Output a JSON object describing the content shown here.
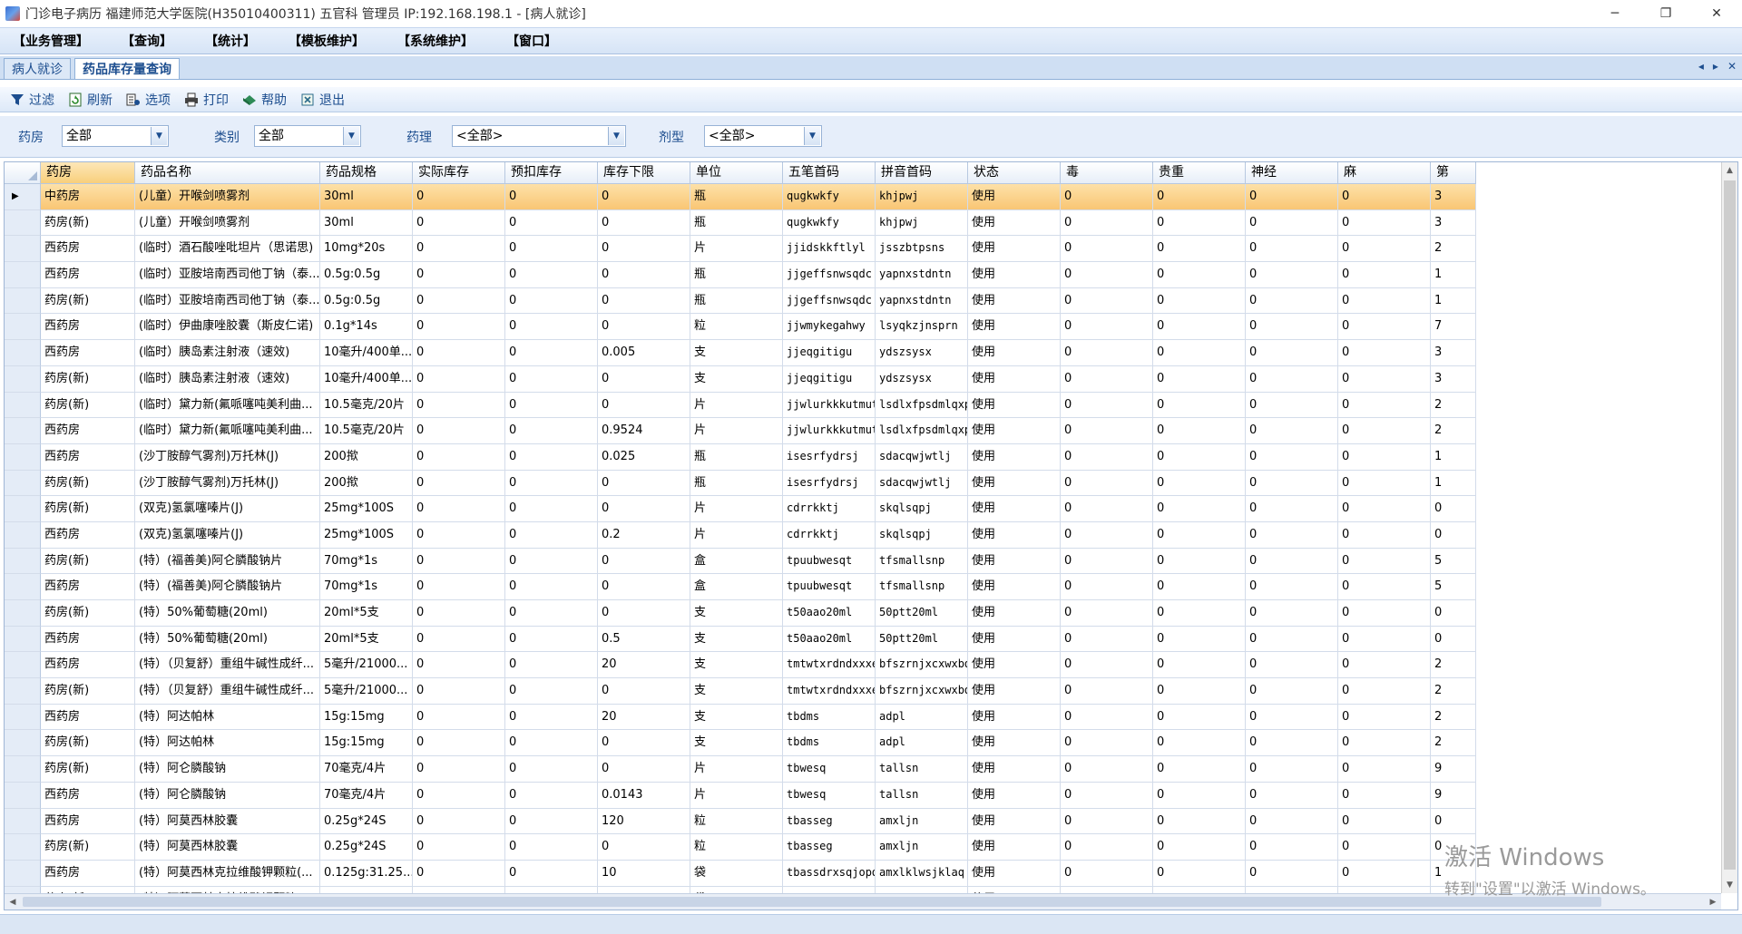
{
  "window": {
    "title": "门诊电子病历  福建师范大学医院(H35010400311)  五官科  管理员 IP:192.168.198.1 - [病人就诊]",
    "min_label": "─",
    "max_label": "❐",
    "close_label": "✕"
  },
  "menu": [
    "【业务管理】",
    "【查询】",
    "【统计】",
    "【模板维护】",
    "【系统维护】",
    "【窗口】"
  ],
  "tabs": {
    "inactive": "病人就诊",
    "active": "药品库存量查询",
    "nav_prev": "◂",
    "nav_next": "▸",
    "nav_close": "✕"
  },
  "toolbar": [
    {
      "label": "过滤",
      "icon": "filter-icon"
    },
    {
      "label": "刷新",
      "icon": "refresh-icon"
    },
    {
      "label": "选项",
      "icon": "options-icon"
    },
    {
      "label": "打印",
      "icon": "print-icon"
    },
    {
      "label": "帮助",
      "icon": "help-icon"
    },
    {
      "label": "退出",
      "icon": "exit-icon"
    }
  ],
  "filters": {
    "pharmacy": {
      "label": "药房",
      "value": "全部"
    },
    "category": {
      "label": "类别",
      "value": "全部"
    },
    "pharmacology": {
      "label": "药理",
      "value": "<全部>"
    },
    "dosage_form": {
      "label": "剂型",
      "value": "<全部>"
    }
  },
  "grid": {
    "columns": [
      "药房",
      "药品名称",
      "药品规格",
      "实际库存",
      "预扣库存",
      "库存下限",
      "单位",
      "五笔首码",
      "拼音首码",
      "状态",
      "毒",
      "贵重",
      "神经",
      "麻",
      "第"
    ],
    "current_row_marker": "▶",
    "rows": [
      [
        "中药房",
        "(儿童）开喉剑喷雾剂",
        "30ml",
        "0",
        "0",
        "0",
        "瓶",
        "qugkwkfy",
        "khjpwj",
        "使用",
        "0",
        "0",
        "0",
        "0",
        "3"
      ],
      [
        "药房(新)",
        "(儿童）开喉剑喷雾剂",
        "30ml",
        "0",
        "0",
        "0",
        "瓶",
        "qugkwkfy",
        "khjpwj",
        "使用",
        "0",
        "0",
        "0",
        "0",
        "3"
      ],
      [
        "西药房",
        "(临时）酒石酸唑吡坦片（思诺思)",
        "10mg*20s",
        "0",
        "0",
        "0",
        "片",
        "jjidskkftlyl",
        "jsszbtpsns",
        "使用",
        "0",
        "0",
        "0",
        "0",
        "2"
      ],
      [
        "西药房",
        "(临时）亚胺培南西司他丁钠（泰...",
        "0.5g:0.5g",
        "0",
        "0",
        "0",
        "瓶",
        "jjgeffsnwsqdc",
        "yapnxstdntn",
        "使用",
        "0",
        "0",
        "0",
        "0",
        "1"
      ],
      [
        "药房(新)",
        "(临时）亚胺培南西司他丁钠（泰...",
        "0.5g:0.5g",
        "0",
        "0",
        "0",
        "瓶",
        "jjgeffsnwsqdc",
        "yapnxstdntn",
        "使用",
        "0",
        "0",
        "0",
        "0",
        "1"
      ],
      [
        "西药房",
        "(临时）伊曲康唑胶囊（斯皮仁诺)",
        "0.1g*14s",
        "0",
        "0",
        "0",
        "粒",
        "jjwmykegahwy",
        "lsyqkzjnsprn",
        "使用",
        "0",
        "0",
        "0",
        "0",
        "7"
      ],
      [
        "西药房",
        "(临时）胰岛素注射液（速效)",
        "10毫升/400单...",
        "0",
        "0",
        "0.005",
        "支",
        "jjeqgitigu",
        "ydszsysx",
        "使用",
        "0",
        "0",
        "0",
        "0",
        "3"
      ],
      [
        "药房(新)",
        "(临时）胰岛素注射液（速效)",
        "10毫升/400单...",
        "0",
        "0",
        "0",
        "支",
        "jjeqgitigu",
        "ydszsysx",
        "使用",
        "0",
        "0",
        "0",
        "0",
        "3"
      ],
      [
        "药房(新)",
        "(临时）黛力新(氟哌噻吨美利曲...",
        "10.5毫克/20片",
        "0",
        "0",
        "0",
        "片",
        "jjwlurkkkutmut",
        "lsdlxfpsdmlqxp",
        "使用",
        "0",
        "0",
        "0",
        "0",
        "2"
      ],
      [
        "西药房",
        "(临时）黛力新(氟哌噻吨美利曲...",
        "10.5毫克/20片",
        "0",
        "0",
        "0.9524",
        "片",
        "jjwlurkkkutmut",
        "lsdlxfpsdmlqxp",
        "使用",
        "0",
        "0",
        "0",
        "0",
        "2"
      ],
      [
        "西药房",
        "(沙丁胺醇气雾剂)万托林(J)",
        "200揿",
        "0",
        "0",
        "0.025",
        "瓶",
        "isesrfydrsj",
        "sdacqwjwtlj",
        "使用",
        "0",
        "0",
        "0",
        "0",
        "1"
      ],
      [
        "药房(新)",
        "(沙丁胺醇气雾剂)万托林(J)",
        "200揿",
        "0",
        "0",
        "0",
        "瓶",
        "isesrfydrsj",
        "sdacqwjwtlj",
        "使用",
        "0",
        "0",
        "0",
        "0",
        "1"
      ],
      [
        "药房(新)",
        "(双克)氢氯噻嗪片(J)",
        "25mg*100S",
        "0",
        "0",
        "0",
        "片",
        "cdrrkktj",
        "skqlsqpj",
        "使用",
        "0",
        "0",
        "0",
        "0",
        "0"
      ],
      [
        "西药房",
        "(双克)氢氯噻嗪片(J)",
        "25mg*100S",
        "0",
        "0",
        "0.2",
        "片",
        "cdrrkktj",
        "skqlsqpj",
        "使用",
        "0",
        "0",
        "0",
        "0",
        "0"
      ],
      [
        "药房(新)",
        "(特）(福善美)阿仑膦酸钠片",
        "70mg*1s",
        "0",
        "0",
        "0",
        "盒",
        "tpuubwesqt",
        "tfsmallsnp",
        "使用",
        "0",
        "0",
        "0",
        "0",
        "5"
      ],
      [
        "西药房",
        "(特）(福善美)阿仑膦酸钠片",
        "70mg*1s",
        "0",
        "0",
        "0",
        "盒",
        "tpuubwesqt",
        "tfsmallsnp",
        "使用",
        "0",
        "0",
        "0",
        "0",
        "5"
      ],
      [
        "药房(新)",
        "(特）50%葡萄糖(20ml)",
        "20ml*5支",
        "0",
        "0",
        "0",
        "支",
        "t50aao20ml",
        "50ptt20ml",
        "使用",
        "0",
        "0",
        "0",
        "0",
        "0"
      ],
      [
        "西药房",
        "(特）50%葡萄糖(20ml)",
        "20ml*5支",
        "0",
        "0",
        "0.5",
        "支",
        "t50aao20ml",
        "50ptt20ml",
        "使用",
        "0",
        "0",
        "0",
        "0",
        "0"
      ],
      [
        "西药房",
        "(特）（贝复舒）重组牛碱性成纤...",
        "5毫升/21000...",
        "0",
        "0",
        "20",
        "支",
        "tmtwtxrdndxxxei",
        "bfszrnjxcxwxbd",
        "使用",
        "0",
        "0",
        "0",
        "0",
        "2"
      ],
      [
        "药房(新)",
        "(特）（贝复舒）重组牛碱性成纤...",
        "5毫升/21000...",
        "0",
        "0",
        "0",
        "支",
        "tmtwtxrdndxxxei",
        "bfszrnjxcxwxbd",
        "使用",
        "0",
        "0",
        "0",
        "0",
        "2"
      ],
      [
        "西药房",
        "(特）阿达帕林",
        "15g:15mg",
        "0",
        "0",
        "20",
        "支",
        "tbdms",
        "adpl",
        "使用",
        "0",
        "0",
        "0",
        "0",
        "2"
      ],
      [
        "药房(新)",
        "(特）阿达帕林",
        "15g:15mg",
        "0",
        "0",
        "0",
        "支",
        "tbdms",
        "adpl",
        "使用",
        "0",
        "0",
        "0",
        "0",
        "2"
      ],
      [
        "药房(新)",
        "(特）阿仑膦酸钠",
        "70毫克/4片",
        "0",
        "0",
        "0",
        "片",
        "tbwesq",
        "tallsn",
        "使用",
        "0",
        "0",
        "0",
        "0",
        "9"
      ],
      [
        "西药房",
        "(特）阿仑膦酸钠",
        "70毫克/4片",
        "0",
        "0",
        "0.0143",
        "片",
        "tbwesq",
        "tallsn",
        "使用",
        "0",
        "0",
        "0",
        "0",
        "9"
      ],
      [
        "西药房",
        "(特）阿莫西林胶囊",
        "0.25g*24S",
        "0",
        "0",
        "120",
        "粒",
        "tbasseg",
        "amxljn",
        "使用",
        "0",
        "0",
        "0",
        "0",
        "0"
      ],
      [
        "药房(新)",
        "(特）阿莫西林胶囊",
        "0.25g*24S",
        "0",
        "0",
        "0",
        "粒",
        "tbasseg",
        "amxljn",
        "使用",
        "0",
        "0",
        "0",
        "0",
        "0"
      ],
      [
        "西药房",
        "(特）阿莫西林克拉维酸钾颗粒(...",
        "0.125g:31.25...",
        "0",
        "0",
        "10",
        "袋",
        "tbassdrxsqjopd",
        "amxlklwsjklaq",
        "使用",
        "0",
        "0",
        "0",
        "0",
        "1"
      ],
      [
        "药房(新)",
        "(特）阿莫西林克拉维酸钾颗粒(...",
        "0.125g:31.25...",
        "0",
        "0",
        "0",
        "袋",
        "tbassdrxsqjopd",
        "amxlklwsjklaq",
        "使用",
        "0",
        "0",
        "0",
        "0",
        "1"
      ]
    ]
  },
  "watermark": {
    "line1": "激活 Windows",
    "line2": "转到\"设置\"以激活 Windows。"
  },
  "colors": {
    "selected_row": "#f9c674",
    "header_bg": "#e6eef8",
    "accent_blue": "#1d4e8f"
  }
}
